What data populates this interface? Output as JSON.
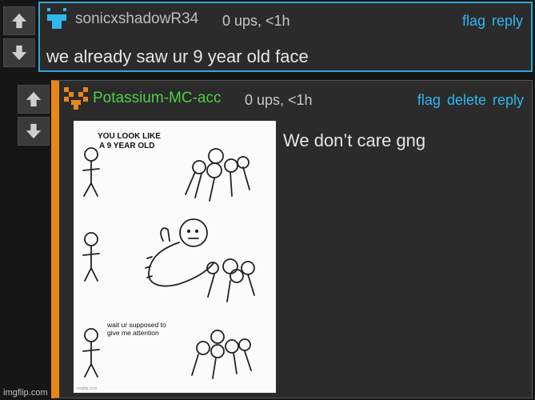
{
  "comment1": {
    "username": "sonicxshadowR34",
    "username_color": "#bdbdbd",
    "meta": "0 ups, <1h",
    "actions": [
      "flag",
      "reply"
    ],
    "text": "we already saw ur 9 year old face",
    "avatar_color": "#2fb7ef"
  },
  "comment2": {
    "username": "Potassium-MC-acc",
    "username_color": "#4ccf4a",
    "meta": "0 ups, <1h",
    "actions": [
      "flag",
      "delete",
      "reply"
    ],
    "text": "We don’t care gng",
    "avatar_color": "#e8861a",
    "meme": {
      "caption1": "YOU LOOK LIKE",
      "caption2": "A 9 YEAR OLD",
      "caption3": "wait ur supposed to",
      "caption4": "give me attention",
      "watermark": "imgflip.com"
    }
  },
  "watermark": "imgflip.com"
}
